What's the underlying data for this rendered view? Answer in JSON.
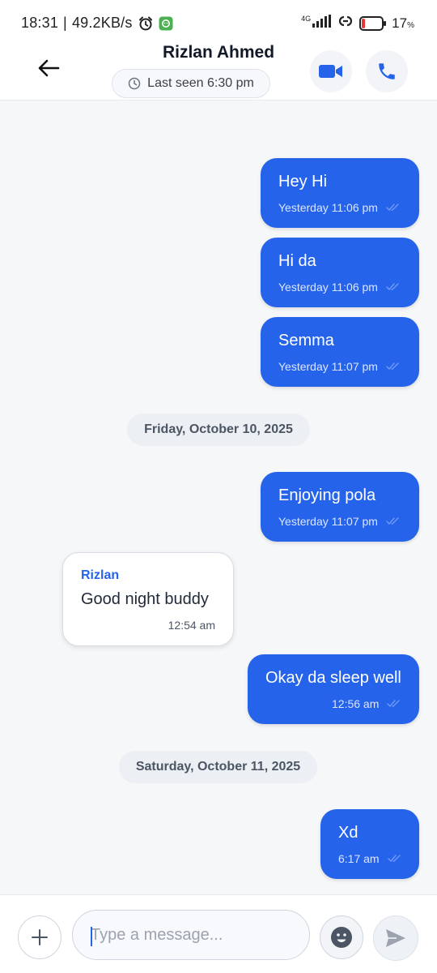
{
  "status_bar": {
    "time": "18:31",
    "separator": "|",
    "speed": "49.2KB/s",
    "network": "4G",
    "battery_percent": "17",
    "battery_unit": "%",
    "battery_level": 0.17
  },
  "header": {
    "contact_name": "Rizlan Ahmed",
    "last_seen": "Last seen 6:30 pm"
  },
  "messages": [
    {
      "direction": "out",
      "text": "Hey Hi",
      "time": "Yesterday 11:06 pm"
    },
    {
      "direction": "out",
      "text": "Hi da",
      "time": "Yesterday 11:06 pm"
    },
    {
      "direction": "out",
      "text": "Semma",
      "time": "Yesterday 11:07 pm"
    },
    {
      "type": "date",
      "text": "Friday, October 10, 2025"
    },
    {
      "direction": "out",
      "text": "Enjoying pola",
      "time": "Yesterday 11:07 pm"
    },
    {
      "direction": "in",
      "sender": "Rizlan",
      "text": "Good night buddy",
      "time": "12:54 am"
    },
    {
      "direction": "out",
      "text": "Okay da sleep well",
      "time": "12:56 am"
    },
    {
      "type": "date",
      "text": "Saturday, October 11, 2025"
    },
    {
      "direction": "out",
      "text": "Xd",
      "time": "6:17 am"
    }
  ],
  "composer": {
    "placeholder": "Type a message..."
  },
  "colors": {
    "accent": "#2563eb",
    "battery_low": "#e53935",
    "app_badge": "#4caf50"
  }
}
